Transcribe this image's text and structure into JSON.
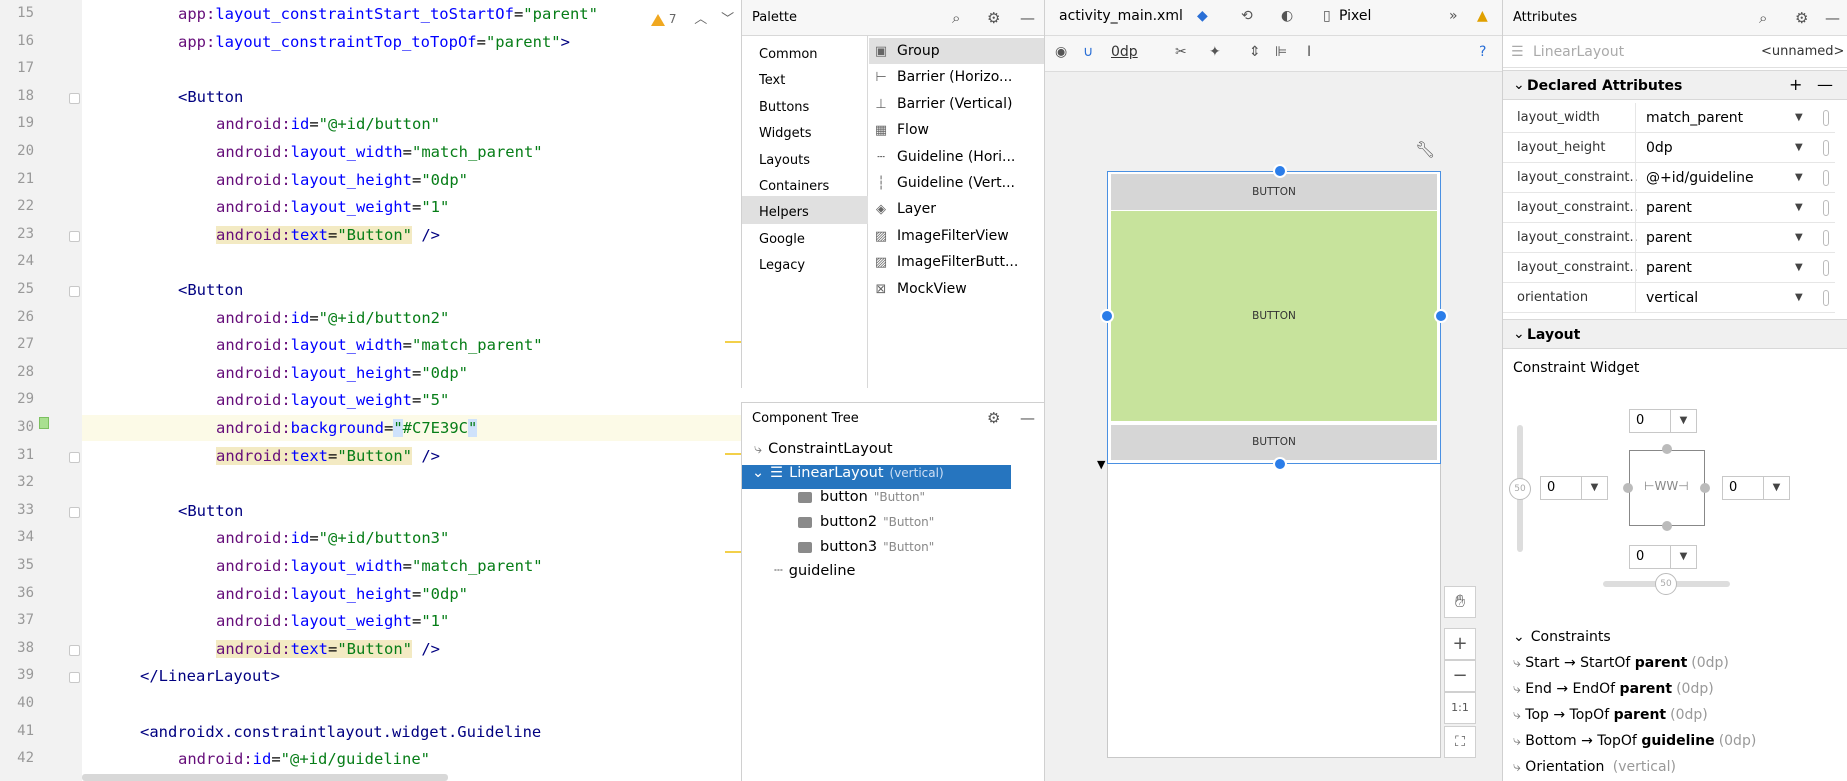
{
  "editor": {
    "warnings_count": "7",
    "lines": [
      {
        "n": "15",
        "parts": [
          [
            "an",
            "app:"
          ],
          [
            "at",
            "layout_constraintStart_toStartOf"
          ],
          [
            "pl",
            "="
          ],
          [
            "av",
            "\"parent\""
          ]
        ]
      },
      {
        "n": "16",
        "parts": [
          [
            "an",
            "app:"
          ],
          [
            "at",
            "layout_constraintTop_toTopOf"
          ],
          [
            "pl",
            "="
          ],
          [
            "av",
            "\"parent\""
          ],
          [
            "tg",
            ">"
          ]
        ]
      },
      {
        "n": "17",
        "parts": []
      },
      {
        "n": "18",
        "parts": [
          [
            "tg",
            "<Button"
          ]
        ]
      },
      {
        "n": "19",
        "parts": [
          [
            "an",
            "android:"
          ],
          [
            "at",
            "id"
          ],
          [
            "pl",
            "="
          ],
          [
            "av",
            "\"@+id/button\""
          ]
        ]
      },
      {
        "n": "20",
        "parts": [
          [
            "an",
            "android:"
          ],
          [
            "at",
            "layout_width"
          ],
          [
            "pl",
            "="
          ],
          [
            "av",
            "\"match_parent\""
          ]
        ]
      },
      {
        "n": "21",
        "parts": [
          [
            "an",
            "android:"
          ],
          [
            "at",
            "layout_height"
          ],
          [
            "pl",
            "="
          ],
          [
            "av",
            "\"0dp\""
          ]
        ]
      },
      {
        "n": "22",
        "parts": [
          [
            "an",
            "android:"
          ],
          [
            "at",
            "layout_weight"
          ],
          [
            "pl",
            "="
          ],
          [
            "av",
            "\"1\""
          ]
        ]
      },
      {
        "n": "23",
        "parts": [
          [
            "an hl",
            "android:"
          ],
          [
            "at hl",
            "text"
          ],
          [
            "pl hl",
            "="
          ],
          [
            "av hl",
            "\"Button\""
          ],
          [
            "tg",
            " />"
          ]
        ]
      },
      {
        "n": "24",
        "parts": []
      },
      {
        "n": "25",
        "parts": [
          [
            "tg",
            "<Button"
          ]
        ]
      },
      {
        "n": "26",
        "parts": [
          [
            "an",
            "android:"
          ],
          [
            "at",
            "id"
          ],
          [
            "pl",
            "="
          ],
          [
            "av",
            "\"@+id/button2\""
          ]
        ]
      },
      {
        "n": "27",
        "parts": [
          [
            "an",
            "android:"
          ],
          [
            "at",
            "layout_width"
          ],
          [
            "pl",
            "="
          ],
          [
            "av",
            "\"match_parent\""
          ]
        ]
      },
      {
        "n": "28",
        "parts": [
          [
            "an",
            "android:"
          ],
          [
            "at",
            "layout_height"
          ],
          [
            "pl",
            "="
          ],
          [
            "av",
            "\"0dp\""
          ]
        ]
      },
      {
        "n": "29",
        "parts": [
          [
            "an",
            "android:"
          ],
          [
            "at",
            "layout_weight"
          ],
          [
            "pl",
            "="
          ],
          [
            "av",
            "\"5\""
          ]
        ]
      },
      {
        "n": "30",
        "parts": [
          [
            "an",
            "android:"
          ],
          [
            "at",
            "background"
          ],
          [
            "pl",
            "="
          ],
          [
            "av caret-hl",
            "\""
          ],
          [
            "av",
            "#C7E39C"
          ],
          [
            "av caret-hl",
            "\""
          ]
        ]
      },
      {
        "n": "31",
        "parts": [
          [
            "an hl",
            "android:"
          ],
          [
            "at hl",
            "text"
          ],
          [
            "pl hl",
            "="
          ],
          [
            "av hl",
            "\"Button\""
          ],
          [
            "tg",
            " />"
          ]
        ]
      },
      {
        "n": "32",
        "parts": []
      },
      {
        "n": "33",
        "parts": [
          [
            "tg",
            "<Button"
          ]
        ]
      },
      {
        "n": "34",
        "parts": [
          [
            "an",
            "android:"
          ],
          [
            "at",
            "id"
          ],
          [
            "pl",
            "="
          ],
          [
            "av",
            "\"@+id/button3\""
          ]
        ]
      },
      {
        "n": "35",
        "parts": [
          [
            "an",
            "android:"
          ],
          [
            "at",
            "layout_width"
          ],
          [
            "pl",
            "="
          ],
          [
            "av",
            "\"match_parent\""
          ]
        ]
      },
      {
        "n": "36",
        "parts": [
          [
            "an",
            "android:"
          ],
          [
            "at",
            "layout_height"
          ],
          [
            "pl",
            "="
          ],
          [
            "av",
            "\"0dp\""
          ]
        ]
      },
      {
        "n": "37",
        "parts": [
          [
            "an",
            "android:"
          ],
          [
            "at",
            "layout_weight"
          ],
          [
            "pl",
            "="
          ],
          [
            "av",
            "\"1\""
          ]
        ]
      },
      {
        "n": "38",
        "parts": [
          [
            "an hl",
            "android:"
          ],
          [
            "at hl",
            "text"
          ],
          [
            "pl hl",
            "="
          ],
          [
            "av hl",
            "\"Button\""
          ],
          [
            "tg",
            " />"
          ]
        ]
      },
      {
        "n": "39",
        "parts": [
          [
            "tg",
            "</LinearLayout>"
          ]
        ]
      },
      {
        "n": "40",
        "parts": []
      },
      {
        "n": "41",
        "parts": [
          [
            "tg",
            "<androidx.constraintlayout.widget.Guideline"
          ]
        ]
      },
      {
        "n": "42",
        "parts": [
          [
            "an",
            "android:"
          ],
          [
            "at",
            "id"
          ],
          [
            "pl",
            "="
          ],
          [
            "av",
            "\"@+id/guideline\""
          ]
        ]
      }
    ]
  },
  "palette": {
    "title": "Palette",
    "categories": [
      "Common",
      "Text",
      "Buttons",
      "Widgets",
      "Layouts",
      "Containers",
      "Helpers",
      "Google",
      "Legacy"
    ],
    "selected_category": "Helpers",
    "items": [
      "Group",
      "Barrier (Horizo...",
      "Barrier (Vertical)",
      "Flow",
      "Guideline (Hori...",
      "Guideline (Vert...",
      "Layer",
      "ImageFilterView",
      "ImageFilterButt...",
      "MockView"
    ]
  },
  "component_tree": {
    "title": "Component Tree",
    "root": "ConstraintLayout",
    "linear": "LinearLayout",
    "linear_sub": "(vertical)",
    "children": [
      {
        "name": "button",
        "text": "\"Button\""
      },
      {
        "name": "button2",
        "text": "\"Button\""
      },
      {
        "name": "button3",
        "text": "\"Button\""
      }
    ],
    "guideline": "guideline"
  },
  "design": {
    "file_tab": "activity_main.xml",
    "device": "Pixel",
    "dp_value": "0dp",
    "button_label": "BUTTON",
    "ratio_label": "1:1",
    "green": "#C7E39C"
  },
  "attributes": {
    "title": "Attributes",
    "component": "LinearLayout",
    "id_placeholder": "<unnamed>",
    "declared_title": "Declared Attributes",
    "rows": [
      {
        "name": "layout_width",
        "value": "match_parent"
      },
      {
        "name": "layout_height",
        "value": "0dp"
      },
      {
        "name": "layout_constraint...",
        "value": "@+id/guideline"
      },
      {
        "name": "layout_constraint...",
        "value": "parent"
      },
      {
        "name": "layout_constraint...",
        "value": "parent"
      },
      {
        "name": "layout_constraint...",
        "value": "parent"
      },
      {
        "name": "orientation",
        "value": "vertical"
      }
    ],
    "layout_title": "Layout",
    "constraint_widget_label": "Constraint Widget",
    "margins": {
      "top": "0",
      "left": "0",
      "right": "0",
      "bottom": "0"
    },
    "bias_vertical": "50",
    "bias_horizontal": "50",
    "constraints_title": "Constraints",
    "constraints": [
      {
        "pre": "Start → StartOf ",
        "target": "parent",
        "dim": "(0dp)"
      },
      {
        "pre": "End → EndOf ",
        "target": "parent",
        "dim": "(0dp)"
      },
      {
        "pre": "Top → TopOf ",
        "target": "parent",
        "dim": "(0dp)"
      },
      {
        "pre": "Bottom → TopOf ",
        "target": "guideline",
        "dim": "(0dp)"
      },
      {
        "pre": "Orientation ",
        "target": "",
        "dim": "(vertical)"
      }
    ]
  }
}
